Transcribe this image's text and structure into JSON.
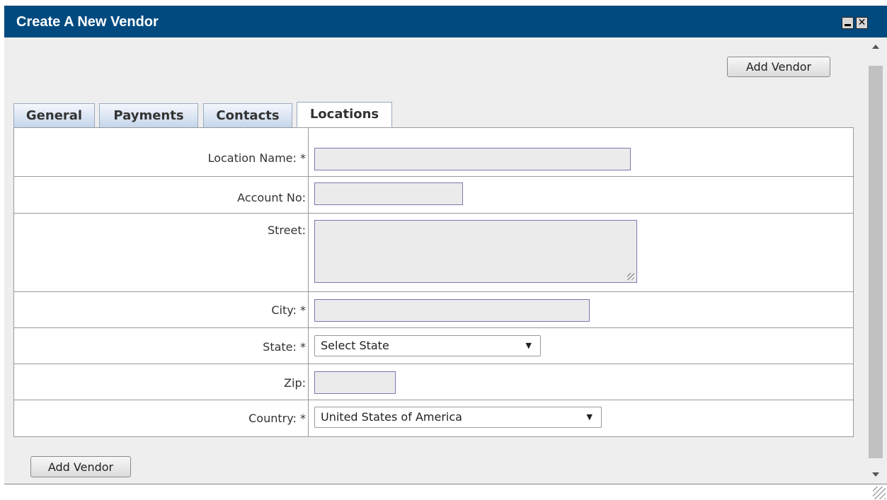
{
  "window": {
    "title": "Create A New Vendor",
    "close_glyph": "✕"
  },
  "top_action": {
    "label": "Add Vendor"
  },
  "bottom_action": {
    "label": "Add Vendor"
  },
  "tabs": [
    {
      "label": "General",
      "active": false
    },
    {
      "label": "Payments",
      "active": false
    },
    {
      "label": "Contacts",
      "active": false
    },
    {
      "label": "Locations",
      "active": true
    }
  ],
  "form": {
    "location_name": {
      "label": "Location Name: *",
      "value": ""
    },
    "account_no": {
      "label": "Account No:",
      "value": ""
    },
    "street": {
      "label": "Street:",
      "value": ""
    },
    "city": {
      "label": "City: *",
      "value": ""
    },
    "state": {
      "label": "State: *",
      "selected": "Select State"
    },
    "zip": {
      "label": "Zip:",
      "value": ""
    },
    "country": {
      "label": "Country: *",
      "selected": "United States of America"
    }
  },
  "colors": {
    "titlebar": "#004a80",
    "panel": "#eeeeee",
    "tab_gradient_top": "#f4f7fc",
    "tab_gradient_bottom": "#c5d6ec",
    "input_background": "#ebebeb",
    "input_border": "#7a7ab0"
  },
  "icons": {
    "minimize": "minimize-icon",
    "close": "close-icon",
    "dropdown": "chevron-down-icon",
    "scroll_up": "scroll-up-arrow-icon",
    "scroll_down": "scroll-down-arrow-icon",
    "resize": "resize-grip-icon"
  }
}
